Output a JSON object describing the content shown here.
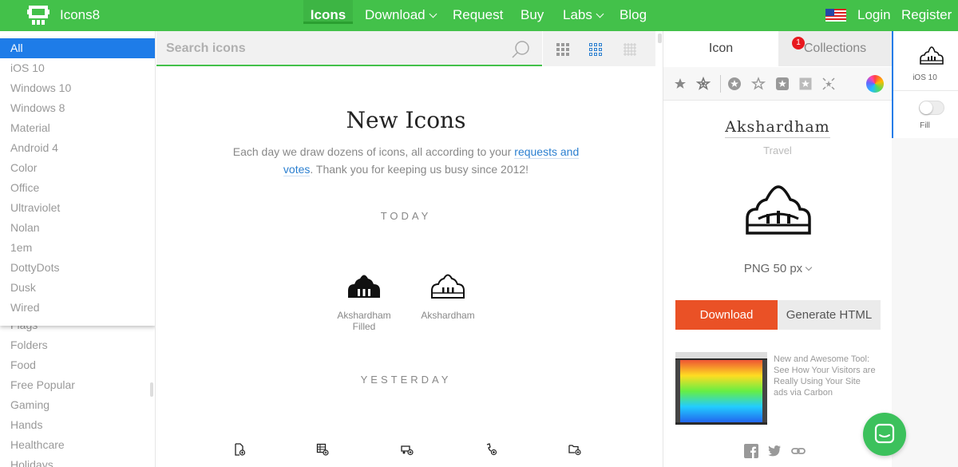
{
  "header": {
    "brand": "Icons8",
    "nav": [
      {
        "label": "Icons"
      },
      {
        "label": "Download"
      },
      {
        "label": "Request"
      },
      {
        "label": "Buy"
      },
      {
        "label": "Labs"
      },
      {
        "label": "Blog"
      }
    ],
    "login": "Login",
    "register": "Register"
  },
  "sidebar": {
    "platforms": [
      "All",
      "iOS 10",
      "Windows 10",
      "Windows 8",
      "Material",
      "Android 4",
      "Color",
      "Office",
      "Ultraviolet",
      "Nolan",
      "1em",
      "DottyDots",
      "Dusk",
      "Wired"
    ],
    "categories": [
      "Flags",
      "Folders",
      "Food",
      "Free Popular",
      "Gaming",
      "Hands",
      "Healthcare",
      "Holidays"
    ]
  },
  "search": {
    "placeholder": "Search icons"
  },
  "main": {
    "title": "New Icons",
    "desc_prefix": "Each day we draw dozens of icons, all according to your ",
    "desc_link": "requests and votes",
    "desc_suffix": ". Thank you for keeping us busy since 2012!",
    "today_label": "TODAY",
    "yesterday_label": "YESTERDAY",
    "today_icons": [
      {
        "name": "Akshardham Filled"
      },
      {
        "name": "Akshardham"
      }
    ]
  },
  "panel": {
    "tab_icon": "Icon",
    "tab_collections": "Collections",
    "collections_count": "1",
    "icon_name": "Akshardham",
    "icon_category": "Travel",
    "png_size": "PNG 50 px",
    "download": "Download",
    "generate_html": "Generate HTML",
    "ad_text": "New and Awesome Tool: See How Your Visitors are Really Using Your Site",
    "ad_via": "ads via Carbon"
  },
  "far_right": {
    "platform_label": "iOS 10",
    "fill_label": "Fill"
  },
  "colors": {
    "brand_green": "#43c14a",
    "active_blue": "#1e7ce8",
    "download_orange": "#ea5126"
  }
}
